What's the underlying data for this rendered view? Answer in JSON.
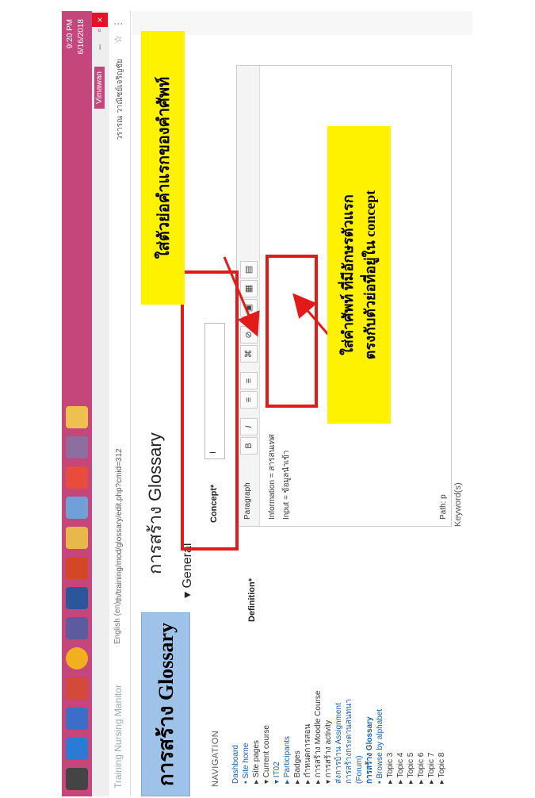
{
  "title_label": "การสร้าง Glossary",
  "browser": {
    "site_title": "Training Nursing Manitor",
    "language": "English (en)",
    "url": "th/training/mod/glossary/edit.php?cmid=312",
    "user_name": "วรารณ วาณิชย์เจริญชัย"
  },
  "taskbar": {
    "time": "9:20 PM",
    "date": "6/16/2018",
    "user_badge": "Vimawan"
  },
  "nav": {
    "title": "NAVIGATION",
    "items": [
      {
        "label": "Dashboard",
        "type": "link"
      },
      {
        "label": "▪ Site home",
        "type": "link"
      },
      {
        "label": "▸ Site pages",
        "type": "plain"
      },
      {
        "label": "▾ Current course",
        "type": "plain"
      },
      {
        "label": "▾ IT02",
        "type": "link"
      },
      {
        "label": "▸ Participants",
        "type": "link"
      },
      {
        "label": "▸ Badges",
        "type": "plain"
      },
      {
        "label": "▸ กำหนดการสอน",
        "type": "plain"
      },
      {
        "label": "▸ การสร้าง Moodle Course",
        "type": "plain"
      },
      {
        "label": "▾ การสร้าง activity",
        "type": "plain"
      },
      {
        "label": "ส่งการบ้าน Assignment",
        "type": "link"
      },
      {
        "label": "การสร้างกระดานสนทนา",
        "type": "link"
      },
      {
        "label": "(Forum)",
        "type": "link"
      },
      {
        "label": "การสร้าง Glossary",
        "type": "bold"
      },
      {
        "label": "▪ Browse by alphabet",
        "type": "link"
      },
      {
        "label": "▸ Topic 3",
        "type": "plain"
      },
      {
        "label": "▸ Topic 4",
        "type": "plain"
      },
      {
        "label": "▸ Topic 5",
        "type": "plain"
      },
      {
        "label": "▸ Topic 6",
        "type": "plain"
      },
      {
        "label": "▸ Topic 7",
        "type": "plain"
      },
      {
        "label": "▸ Topic 8",
        "type": "plain"
      }
    ]
  },
  "main": {
    "page_title": "การสร้าง Glossary",
    "section": "▾ General",
    "concept_label": "Concept*",
    "concept_value": "I",
    "definition_label": "Definition*",
    "editor": {
      "format": "Paragraph",
      "tools": [
        "B",
        "I",
        "≡",
        "≡",
        "⌘",
        "⊘",
        "▣",
        "▦",
        "▤"
      ],
      "line1": "Information = สารสนเทศ",
      "line2": "Input = ข้อมูลนำเข้า",
      "path": "Path: p"
    },
    "keywords_label": "Keyword(s)"
  },
  "callouts": {
    "top": "ใส่ตัวย่อคำแรกของคำศัพท์",
    "bottom_line1": "ใส่คำศัพท์ ที่มีอักษรตัวแรก",
    "bottom_line2": "ตรงกับตัวย่อที่อยู่ใน concept"
  },
  "colors": {
    "taskbar": "#c4467a",
    "title_box": "#9fc3e8",
    "callout": "#fff200",
    "highlight": "#e21a1a"
  }
}
